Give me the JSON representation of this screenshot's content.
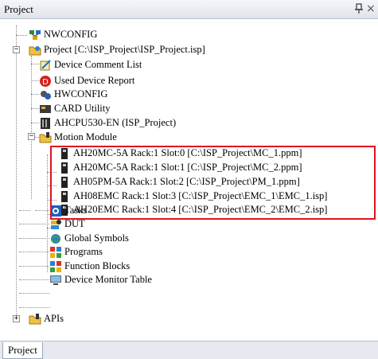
{
  "window": {
    "title": "Project",
    "pin_glyph": "■",
    "close_glyph": "×"
  },
  "tree": {
    "nwconfig": "NWCONFIG",
    "project": "Project [C:\\ISP_Project\\ISP_Project.isp]",
    "device_comment_list": "Device Comment List",
    "used_device_report": "Used Device Report",
    "hwconfig": "HWCONFIG",
    "card_utility": "CARD Utility",
    "cpu": "AHCPU530-EN  (ISP_Project)",
    "motion_module": "Motion Module",
    "motion_items": [
      "AH20MC-5A Rack:1 Slot:0 [C:\\ISP_Project\\MC_1.ppm]",
      "AH20MC-5A Rack:1 Slot:1 [C:\\ISP_Project\\MC_2.ppm]",
      "AH05PM-5A Rack:1 Slot:2 [C:\\ISP_Project\\PM_1.ppm]",
      "AH08EMC Rack:1 Slot:3 [C:\\ISP_Project\\EMC_1\\EMC_1.isp]",
      "AH20EMC Rack:1 Slot:4 [C:\\ISP_Project\\EMC_2\\EMC_2.isp]"
    ],
    "tasks": "Tasks",
    "dut": "DUT",
    "global_symbols": "Global Symbols",
    "programs": "Programs",
    "function_blocks": "Function Blocks",
    "device_monitor_table": "Device Monitor Table",
    "apis": "APIs",
    "expand_collapsed": "+",
    "expand_open": "−"
  },
  "bottom_tab": {
    "label": "Project"
  },
  "colors": {
    "highlight": "#e0141e",
    "header_bg": "#dfe4ec"
  }
}
